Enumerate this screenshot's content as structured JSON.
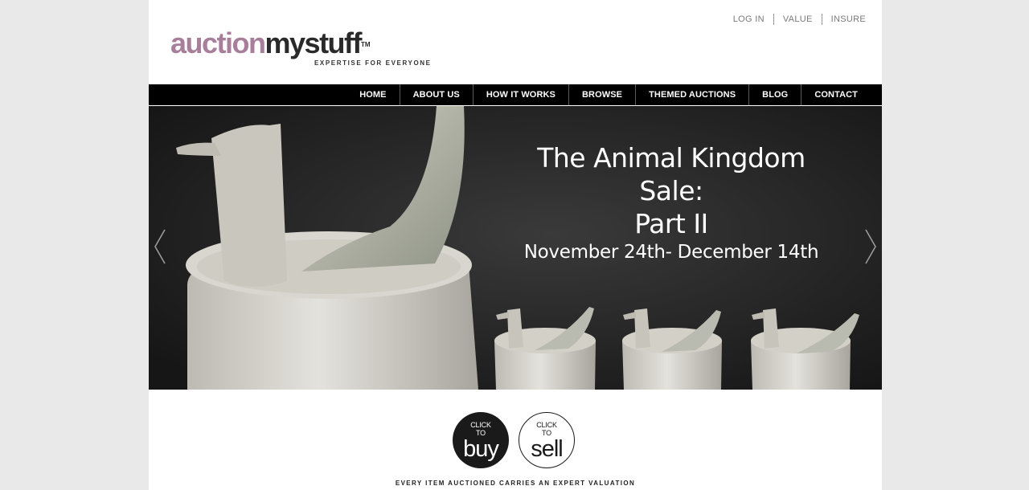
{
  "header": {
    "top_links": [
      "LOG IN",
      "VALUE",
      "INSURE"
    ],
    "logo": {
      "part1": "auction",
      "part2": "mystuff",
      "tm": "TM",
      "tagline": "EXPERTISE FOR EVERYONE"
    }
  },
  "nav": {
    "items": [
      "HOME",
      "ABOUT US",
      "HOW IT WORKS",
      "BROWSE",
      "THEMED AUCTIONS",
      "BLOG",
      "CONTACT"
    ]
  },
  "hero": {
    "title_line1": "The Animal Kingdom Sale:",
    "title_line2": "Part II",
    "dates": "November 24th- December 14th",
    "prev_icon": "chevron-left-icon",
    "next_icon": "chevron-right-icon"
  },
  "cta": {
    "buy": {
      "small1": "CLICK",
      "small2": "TO",
      "big": "buy"
    },
    "sell": {
      "small1": "CLICK",
      "small2": "TO",
      "big": "sell"
    }
  },
  "footer_note": "EVERY ITEM AUCTIONED CARRIES AN EXPERT VALUATION",
  "colors": {
    "logo_accent": "#a77f9a",
    "nav_bg": "#000000",
    "page_bg": "#e9e9e9"
  }
}
